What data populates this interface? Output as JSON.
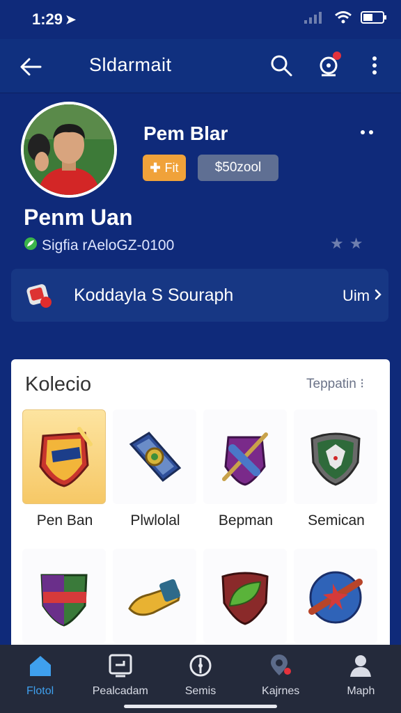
{
  "status": {
    "time": "1:29"
  },
  "app_bar": {
    "title": "Sldarmait"
  },
  "profile": {
    "top_name": "Pem Blar",
    "gold_badge_text": "Fit",
    "gray_badge_text": "$50zool",
    "name": "Penm Uan",
    "subtitle": "Sigfia rAeloGZ-0100"
  },
  "link_card": {
    "label": "Koddayla S Souraph",
    "action": "Uim"
  },
  "collection": {
    "title": "Kolecio",
    "action": "Teppatin",
    "items": [
      {
        "label": "Pen Ban",
        "icon": "emblem-shield-icon"
      },
      {
        "label": "Plwlolal",
        "icon": "sword-badge-icon"
      },
      {
        "label": "Bepman",
        "icon": "crossed-sword-icon"
      },
      {
        "label": "Semican",
        "icon": "wolf-shield-icon"
      },
      {
        "label": "",
        "icon": "aleoxo-shield-icon"
      },
      {
        "label": "",
        "icon": "golden-scroll-icon"
      },
      {
        "label": "",
        "icon": "leaf-shield-icon"
      },
      {
        "label": "",
        "icon": "orb-icon"
      }
    ]
  },
  "bottom_nav": [
    {
      "label": "Flotol",
      "icon": "home-icon"
    },
    {
      "label": "Pealcadam",
      "icon": "board-icon"
    },
    {
      "label": "Semis",
      "icon": "compass-icon"
    },
    {
      "label": "Kajrnes",
      "icon": "location-icon"
    },
    {
      "label": "Maph",
      "icon": "person-icon"
    }
  ],
  "colors": {
    "background": "#0f2a7a",
    "gold": "#f0a23a",
    "nav_active": "#3fa0ee",
    "nav_bg": "#242a3b"
  }
}
